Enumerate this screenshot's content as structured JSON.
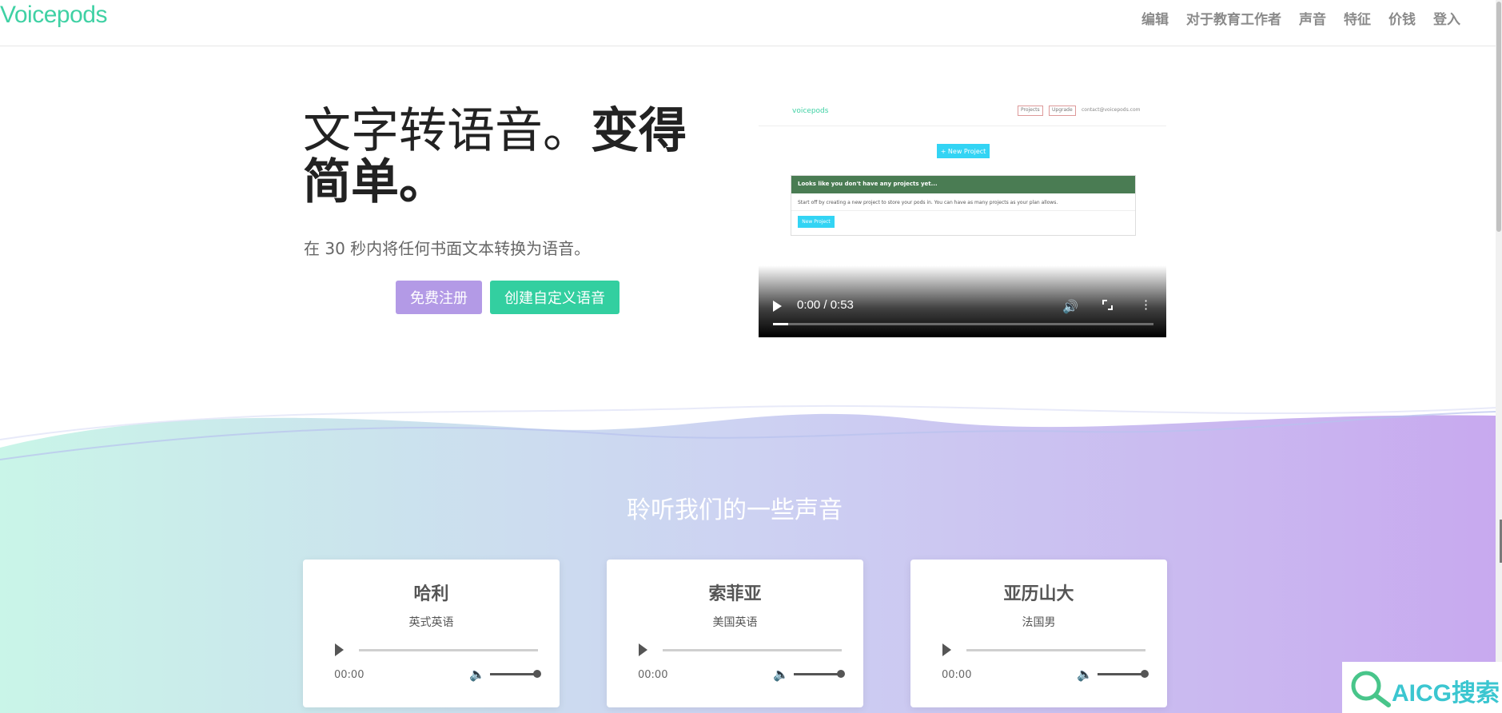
{
  "brand": {
    "logo": "Voicepods",
    "accent": "#3fd1a4"
  },
  "nav": {
    "items": [
      "编辑",
      "对于教育工作者",
      "声音",
      "特征",
      "价钱",
      "登入"
    ]
  },
  "hero": {
    "title_light": "文字转语音。",
    "title_bold": "变得简单。",
    "subtitle": "在 30 秒内将任何书面文本转换为语音。",
    "signup_label": "免费注册",
    "custom_voice_label": "创建自定义语音",
    "signup_color": "#b39ae6",
    "custom_color": "#33cfa0"
  },
  "video": {
    "time": "0:00 / 0:53",
    "progress": 0.04,
    "inner": {
      "logo": "voicepods",
      "tab1": "Projects",
      "tab2": "Upgrade",
      "email": "contact@voicepods.com",
      "new_project": "+ New Project",
      "panel_title": "Looks like you don't have any projects yet...",
      "panel_text": "Start off by creating a new project to store your pods in. You can have as many projects as your plan allows.",
      "panel_button": "New Project"
    }
  },
  "voices": {
    "title": "聆听我们的一些声音",
    "cards": [
      {
        "name": "哈利",
        "accent": "英式英语",
        "time": "00:00"
      },
      {
        "name": "索菲亚",
        "accent": "美国英语",
        "time": "00:00"
      },
      {
        "name": "亚历山大",
        "accent": "法国男",
        "time": "00:00"
      }
    ]
  },
  "watermark": {
    "text": "AICG搜索"
  }
}
